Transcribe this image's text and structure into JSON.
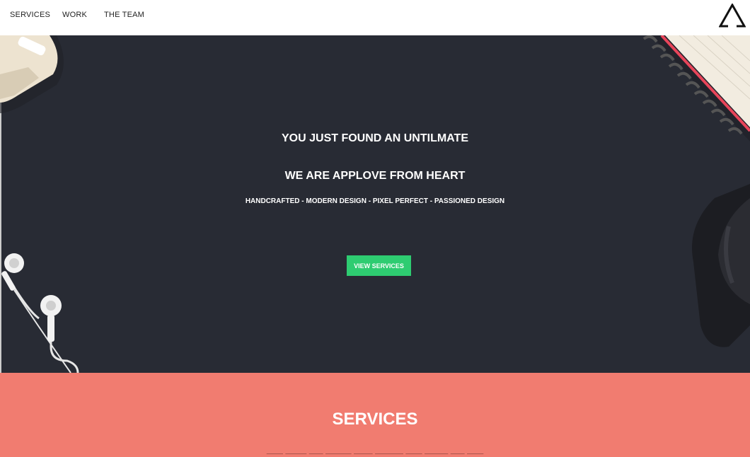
{
  "nav": {
    "items": [
      {
        "label": "SERVICES"
      },
      {
        "label": "WORK"
      },
      {
        "label": "THE TEAM"
      }
    ],
    "logo_icon": "triangle-logo-icon"
  },
  "hero": {
    "line1": "YOU JUST FOUND AN UNTILMATE",
    "line2": "WE ARE APPLOVE FROM HEART",
    "tagline": "HANDCRAFTED - MODERN DESIGN - PIXEL PERFECT - PASSIONED DESIGN",
    "button_label": "VIEW SERVICES",
    "decor_icons": [
      "plug-icon",
      "notebook-icon",
      "glasses-icon",
      "earphones-icon"
    ]
  },
  "services": {
    "title": "SERVICES"
  },
  "colors": {
    "hero_bg": "#282b34",
    "accent_green": "#2ecc71",
    "services_bg": "#f17c70"
  }
}
